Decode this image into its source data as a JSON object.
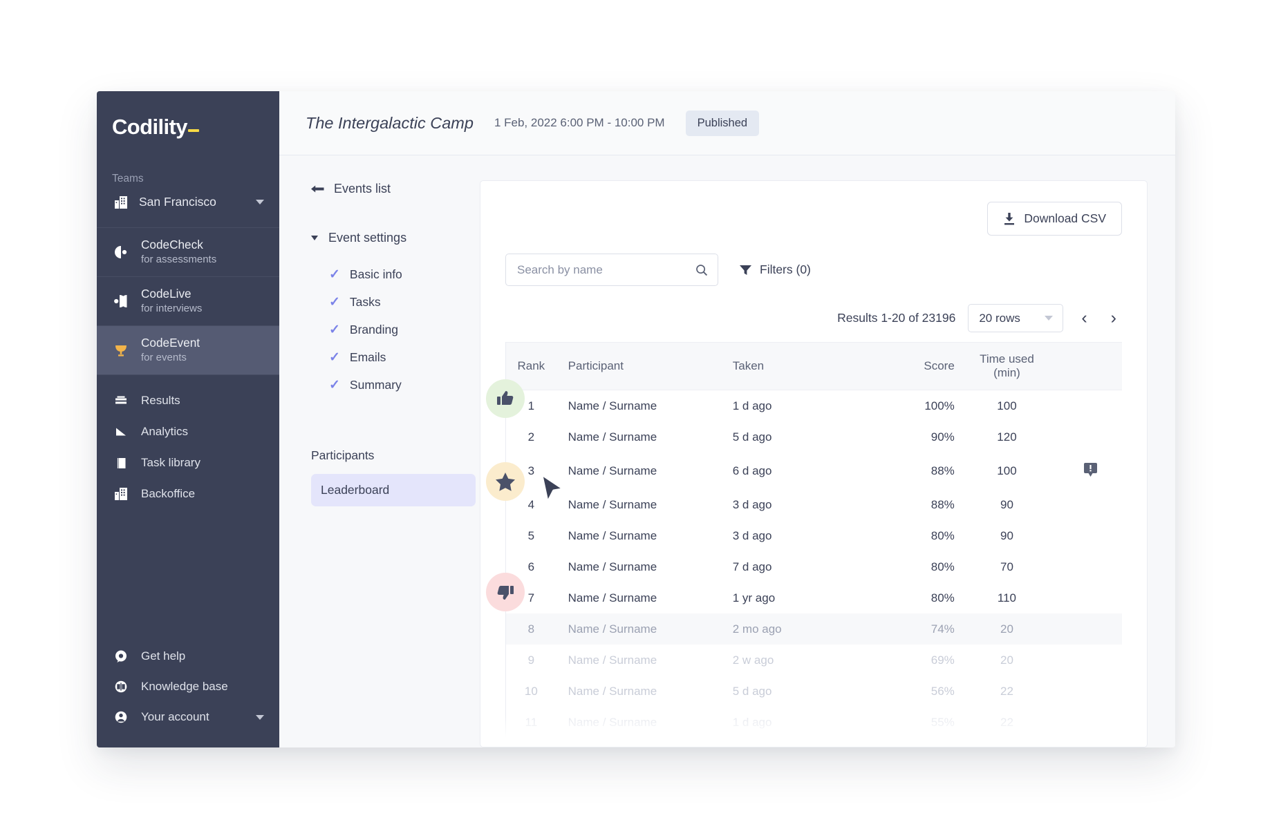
{
  "sidebar": {
    "brand": "Codility",
    "teams_label": "Teams",
    "team_name": "San Francisco",
    "products": [
      {
        "name": "CodeCheck",
        "sub": "for assessments",
        "icon": "codecheck-icon",
        "active": false
      },
      {
        "name": "CodeLive",
        "sub": "for interviews",
        "icon": "codelive-icon",
        "active": false
      },
      {
        "name": "CodeEvent",
        "sub": "for events",
        "icon": "trophy-icon",
        "active": true
      }
    ],
    "links": [
      {
        "label": "Results",
        "icon": "results-icon"
      },
      {
        "label": "Analytics",
        "icon": "analytics-icon"
      },
      {
        "label": "Task library",
        "icon": "book-icon"
      },
      {
        "label": "Backoffice",
        "icon": "building-icon"
      }
    ],
    "bottom": [
      {
        "label": "Get help",
        "icon": "chat-icon"
      },
      {
        "label": "Knowledge base",
        "icon": "book-open-icon"
      },
      {
        "label": "Your account",
        "icon": "account-icon"
      }
    ]
  },
  "header": {
    "title": "The Intergalactic Camp",
    "date": "1 Feb, 2022 6:00 PM - 10:00 PM",
    "status": "Published"
  },
  "subnav": {
    "back_link": "Events list",
    "section_title": "Event settings",
    "settings_items": [
      {
        "label": "Basic info"
      },
      {
        "label": "Tasks"
      },
      {
        "label": "Branding"
      },
      {
        "label": "Emails"
      },
      {
        "label": "Summary"
      }
    ],
    "group_title": "Participants",
    "selected_item": "Leaderboard"
  },
  "toolbar": {
    "download_label": "Download CSV",
    "search_placeholder": "Search by name",
    "search_value": "",
    "filters_label": "Filters (0)",
    "results_text": "Results 1-20 of 23196",
    "rows_select": "20 rows"
  },
  "table": {
    "columns": [
      "Rank",
      "Participant",
      "Taken",
      "Score",
      "Time used\n(min)"
    ],
    "col_time_line1": "Time used",
    "col_time_line2": "(min)",
    "rows": [
      {
        "rank": "1",
        "participant": "Name / Surname",
        "taken": "1 d ago",
        "score": "100%",
        "time": "100",
        "flag": false,
        "badge": "thumbs-up",
        "fade": 0,
        "highlight": false
      },
      {
        "rank": "2",
        "participant": "Name / Surname",
        "taken": "5 d ago",
        "score": "90%",
        "time": "120",
        "flag": false,
        "badge": null,
        "fade": 0,
        "highlight": false
      },
      {
        "rank": "3",
        "participant": "Name / Surname",
        "taken": "6 d ago",
        "score": "88%",
        "time": "100",
        "flag": true,
        "badge": null,
        "fade": 0,
        "highlight": false
      },
      {
        "rank": "4",
        "participant": "Name / Surname",
        "taken": "3 d ago",
        "score": "88%",
        "time": "90",
        "flag": false,
        "badge": "star",
        "fade": 0,
        "highlight": false
      },
      {
        "rank": "5",
        "participant": "Name / Surname",
        "taken": "3 d ago",
        "score": "80%",
        "time": "90",
        "flag": false,
        "badge": null,
        "fade": 0,
        "highlight": false
      },
      {
        "rank": "6",
        "participant": "Name / Surname",
        "taken": "7 d ago",
        "score": "80%",
        "time": "70",
        "flag": false,
        "badge": null,
        "fade": 0,
        "highlight": false
      },
      {
        "rank": "7",
        "participant": "Name / Surname",
        "taken": "1 yr ago",
        "score": "80%",
        "time": "110",
        "flag": false,
        "badge": null,
        "fade": 0,
        "highlight": false
      },
      {
        "rank": "8",
        "participant": "Name / Surname",
        "taken": "2 mo ago",
        "score": "74%",
        "time": "20",
        "flag": false,
        "badge": "thumbs-down",
        "fade": 1,
        "highlight": true
      },
      {
        "rank": "9",
        "participant": "Name / Surname",
        "taken": "2 w ago",
        "score": "69%",
        "time": "20",
        "flag": false,
        "badge": null,
        "fade": 2,
        "highlight": false
      },
      {
        "rank": "10",
        "participant": "Name / Surname",
        "taken": "5 d ago",
        "score": "56%",
        "time": "22",
        "flag": false,
        "badge": null,
        "fade": 2,
        "highlight": false
      },
      {
        "rank": "11",
        "participant": "Name / Surname",
        "taken": "1 d ago",
        "score": "55%",
        "time": "22",
        "flag": false,
        "badge": null,
        "fade": 3,
        "highlight": false
      }
    ]
  },
  "colors": {
    "sidebar_bg": "#3b4157",
    "accent_yellow": "#f7d945",
    "check_purple": "#7b83e8",
    "selected_pill": "#e4e5fb",
    "badge_green": "#e4f2dc",
    "badge_cream": "#fbeccd",
    "badge_pink": "#fbdcdd",
    "trophy_gold": "#f2b44a"
  }
}
